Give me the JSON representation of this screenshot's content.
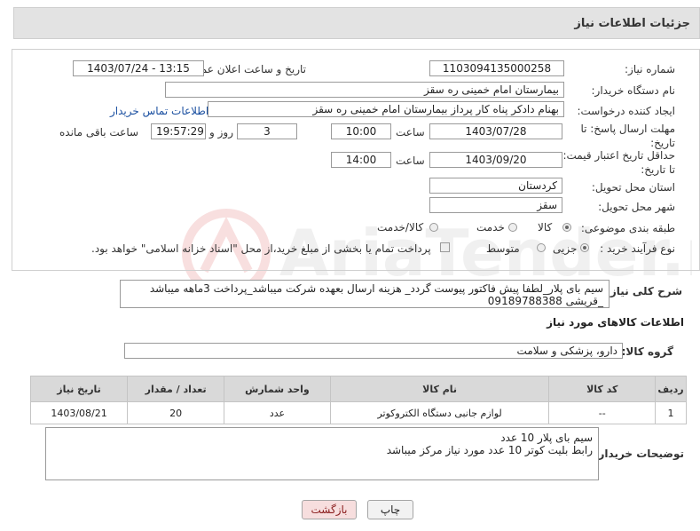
{
  "header": {
    "title": "جزئیات اطلاعات نیاز"
  },
  "form": {
    "need_number_label": "شماره نیاز:",
    "need_number": "1103094135000258",
    "announce_label": "تاریخ و ساعت اعلان عمومی:",
    "announce_value": "1403/07/24 - 13:15",
    "buyer_org_label": "نام دستگاه خریدار:",
    "buyer_org": "بیمارستان امام خمینی  ره  سقز",
    "requester_label": "ایجاد کننده درخواست:",
    "requester": "بهنام دادکر پناه کار پرداز بیمارستان امام خمینی  ره  سقز",
    "contact_link": "اطلاعات تماس خریدار",
    "deadline_label": "مهلت ارسال پاسخ: تا تاریخ:",
    "deadline_date": "1403/07/28",
    "time_label": "ساعت",
    "deadline_time": "10:00",
    "days_value": "3",
    "days_label": "روز و",
    "remaining_time": "19:57:29",
    "remaining_label": "ساعت باقی مانده",
    "validity_label": "حداقل تاریخ اعتبار قیمت: تا تاریخ:",
    "validity_date": "1403/09/20",
    "validity_time": "14:00",
    "province_label": "استان محل تحویل:",
    "province": "کردستان",
    "city_label": "شهر محل تحویل:",
    "city": "سقز",
    "category_label": "طبقه بندی موضوعی:",
    "category_options": [
      "کالا",
      "خدمت",
      "کالا/خدمت"
    ],
    "process_label": "نوع فرآیند خرید :",
    "process_options": [
      "جزیی",
      "متوسط"
    ],
    "treasury_note": "پرداخت تمام یا بخشی از مبلغ خرید،از محل \"اسناد خزانه اسلامی\" خواهد بود."
  },
  "description": {
    "label": "شرح کلی نیاز:",
    "text": "سیم بای پلار_لطفا پیش فاکتور پیوست گردد_ هزینه ارسال بعهده شرکت میباشد_پرداخت 3ماهه میباشد _قریشی  09189788388"
  },
  "goods": {
    "section_title": "اطلاعات کالاهای مورد نیاز",
    "group_label": "گروه کالا:",
    "group_value": "دارو، پزشکی و سلامت",
    "columns": [
      "ردیف",
      "کد کالا",
      "نام کالا",
      "واحد شمارش",
      "تعداد / مقدار",
      "تاریخ نیاز"
    ],
    "rows": [
      [
        "1",
        "--",
        "لوازم جانبی دستگاه الکتروکوتر",
        "عدد",
        "20",
        "1403/08/21"
      ]
    ]
  },
  "buyer_notes": {
    "label": "توضیحات خریدار:",
    "line1": "سیم بای پلار 10 عدد",
    "line2": "رابط بلیت کوتر 10 عدد مورد نیاز مرکز میباشد"
  },
  "buttons": {
    "print": "چاپ",
    "back": "بازگشت"
  },
  "watermark": {
    "text": "AriaTender.neT"
  },
  "colors": {
    "link": "#1a4fa0",
    "header_bg": "#e3e3e3",
    "back_bg": "#f7dede",
    "print_bg": "#f2f2f2"
  }
}
